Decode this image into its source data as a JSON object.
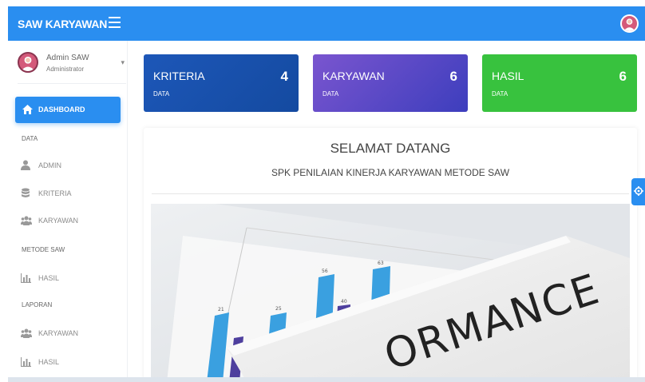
{
  "app": {
    "brand": "SAW KARYAWAN"
  },
  "user": {
    "name": "Admin SAW",
    "role": "Administrator"
  },
  "sidebar": {
    "dashboard": "DASHBOARD",
    "sections": [
      {
        "label": "DATA",
        "items": [
          {
            "label": "ADMIN",
            "icon": "user-icon"
          },
          {
            "label": "KRITERIA",
            "icon": "database-icon"
          },
          {
            "label": "KARYAWAN",
            "icon": "users-icon"
          }
        ]
      },
      {
        "label": "METODE SAW",
        "items": [
          {
            "label": "HASIL",
            "icon": "bar-chart-icon"
          }
        ]
      },
      {
        "label": "LAPORAN",
        "items": [
          {
            "label": "KARYAWAN",
            "icon": "users-icon"
          },
          {
            "label": "HASIL",
            "icon": "bar-chart-icon"
          }
        ]
      }
    ]
  },
  "cards": [
    {
      "title": "KRITERIA",
      "sub": "DATA",
      "count": "4",
      "color": "#1d57b8"
    },
    {
      "title": "KARYAWAN",
      "sub": "DATA",
      "count": "6",
      "color": "#5a48c8"
    },
    {
      "title": "HASIL",
      "sub": "DATA",
      "count": "6",
      "color": "#38c23e"
    }
  ],
  "welcome": {
    "title": "SELAMAT DATANG",
    "subtitle": "SPK PENILAIAN KINERJA KARYAWAN METODE SAW",
    "image_text": "ORMANCE",
    "image_bar_labels": [
      "21",
      "25",
      "40",
      "56",
      "63"
    ]
  },
  "colors": {
    "primary": "#2a8ef0",
    "accent_green": "#38c23e",
    "avatar": "#d45a7a"
  }
}
